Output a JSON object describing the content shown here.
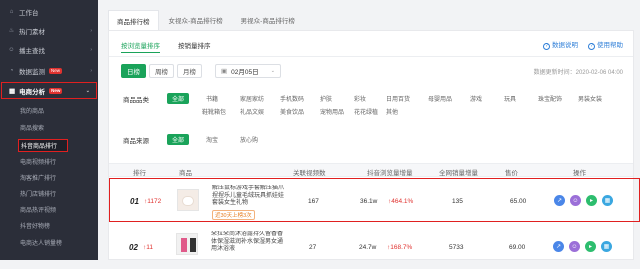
{
  "sidebar": {
    "items": [
      {
        "label": "工作台",
        "icon": "home-icon"
      },
      {
        "label": "热门素材",
        "icon": "fire-icon"
      },
      {
        "label": "播主查找",
        "icon": "user-search-icon"
      },
      {
        "label": "数据监测",
        "icon": "monitor-icon",
        "badge": "New"
      }
    ],
    "group": {
      "label": "电商分析",
      "badge": "New",
      "icon": "cart-icon"
    },
    "subitems": [
      "我的商品",
      "商品搜索",
      "抖音商品排行",
      "电商视频排行",
      "淘客推广排行",
      "热门店铺排行",
      "商品热评视频",
      "抖音好物榜",
      "电商达人销量榜"
    ],
    "active_index": 2
  },
  "tabs": [
    "商品排行榜",
    "女视众-商品排行榜",
    "男视众-商品排行榜"
  ],
  "subtabs": [
    "按浏览量排序",
    "按销量排序"
  ],
  "links": {
    "data_desc": "数据说明",
    "help": "使用帮助"
  },
  "period": {
    "options": [
      "日榜",
      "周榜",
      "月榜"
    ],
    "active": 0,
    "date": "02月05日"
  },
  "updated": "数据更新时间：2020-02-06 04:00",
  "filters": {
    "category_label": "商品品类",
    "category_row1": [
      "全部",
      "书籍",
      "家居家纺",
      "手机数码",
      "护肤",
      "彩妆",
      "日用百货",
      "母婴用品",
      "游戏",
      "玩具",
      "珠宝配饰",
      "男装女装"
    ],
    "category_row2": [
      "鞋靴箱包",
      "礼品文娱",
      "美食饮品",
      "宠物用品",
      "花花绿植",
      "其他"
    ],
    "source_label": "商品来源",
    "source": [
      "全部",
      "淘宝",
      "放心购"
    ]
  },
  "table": {
    "headers": [
      "排行",
      "商品",
      "关联视频数",
      "抖音浏览量增量",
      "全网销量增量",
      "售价",
      "操作"
    ],
    "rows": [
      {
        "rank": "01",
        "change": "↑1172",
        "name": "解压鼠标游戏手套解压猫爪捏捏乐儿童毛绒玩具抓娃娃套装女生礼物",
        "tag": "近30天上榜3次",
        "videos": "167",
        "views": "36.1w",
        "views_growth": "↑464.1%",
        "sales": "135",
        "price": "65.00"
      },
      {
        "rank": "02",
        "change": "↑11",
        "name": "朵拉朵尚沐浴露持久留香香体保湿滋润补水保湿男女通用沐浴液",
        "tag": "",
        "videos": "27",
        "views": "24.7w",
        "views_growth": "↑168.7%",
        "sales": "5733",
        "price": "69.00"
      }
    ]
  },
  "colors": {
    "accent": "#1aa35a",
    "highlight": "#e02020",
    "sidebar": "#2b2e39"
  }
}
